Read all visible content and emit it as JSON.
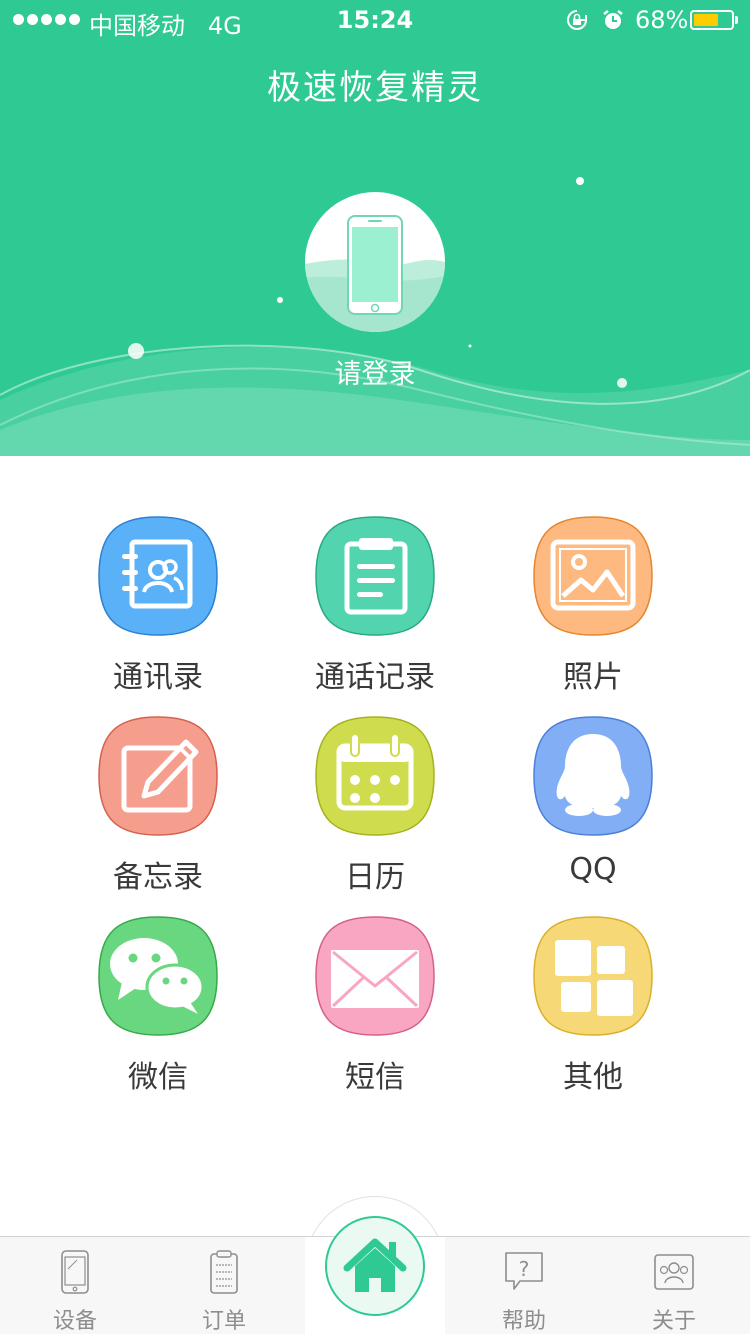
{
  "status_bar": {
    "carrier": "中国移动",
    "network": "4G",
    "time": "15:24",
    "battery_percent": "68%",
    "battery_level": 0.68,
    "battery_color": "#ffcc00",
    "lock_icon": "orientation-lock-icon",
    "alarm_icon": "alarm-clock-icon"
  },
  "header": {
    "title": "极速恢复精灵",
    "login_prompt": "请登录",
    "background_color": "#2fca93",
    "avatar_icon": "phone-icon"
  },
  "grid": {
    "items": [
      {
        "label": "通讯录",
        "icon": "contacts-icon",
        "color": "#5ab1f8"
      },
      {
        "label": "通话记录",
        "icon": "call-log-icon",
        "color": "#52d4ae"
      },
      {
        "label": "照片",
        "icon": "photo-icon",
        "color": "#fdb97f"
      },
      {
        "label": "备忘录",
        "icon": "memo-icon",
        "color": "#f59e8e"
      },
      {
        "label": "日历",
        "icon": "calendar-icon",
        "color": "#cfdc4d"
      },
      {
        "label": "QQ",
        "icon": "qq-penguin-icon",
        "color": "#82aef5"
      },
      {
        "label": "微信",
        "icon": "wechat-icon",
        "color": "#69d77f"
      },
      {
        "label": "短信",
        "icon": "envelope-icon",
        "color": "#f8a6c2"
      },
      {
        "label": "其他",
        "icon": "other-apps-icon",
        "color": "#f7d877"
      }
    ]
  },
  "tabbar": {
    "tabs": [
      {
        "label": "设备",
        "icon": "device-icon"
      },
      {
        "label": "订单",
        "icon": "order-icon"
      },
      {
        "label": "帮助",
        "icon": "help-icon"
      },
      {
        "label": "关于",
        "icon": "about-icon"
      }
    ],
    "home_icon": "home-icon",
    "accent_color": "#2fca93"
  }
}
